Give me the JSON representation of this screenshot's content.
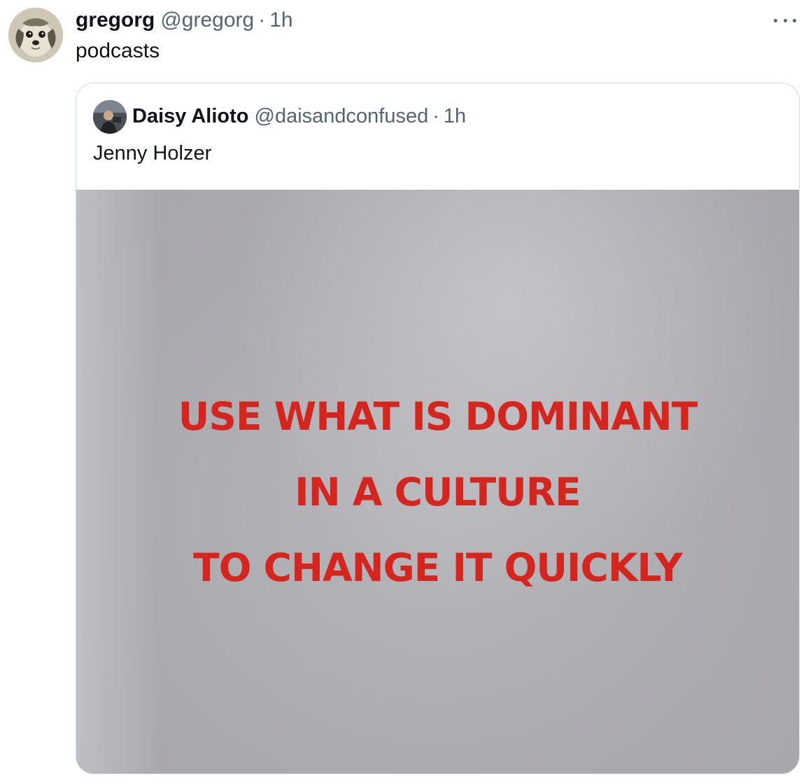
{
  "tweet": {
    "display_name": "gregorg",
    "handle": "@gregorg",
    "separator": "·",
    "time": "1h",
    "text": "podcasts",
    "avatar_icon": "dog-avatar-icon",
    "more_icon": "more-options-icon"
  },
  "quote": {
    "display_name": "Daisy Alioto",
    "handle": "@daisandconfused",
    "separator": "·",
    "time": "1h",
    "text": "Jenny Holzer",
    "avatar_icon": "user-avatar-icon",
    "media": {
      "lines": [
        "USE WHAT IS DOMINANT",
        "IN A CULTURE",
        "TO CHANGE IT QUICKLY"
      ],
      "text_color": "#d4261f",
      "background_color": "#ababaf"
    }
  },
  "colors": {
    "primary_text": "#0f1419",
    "secondary_text": "#536471",
    "border": "#cfd9de"
  }
}
